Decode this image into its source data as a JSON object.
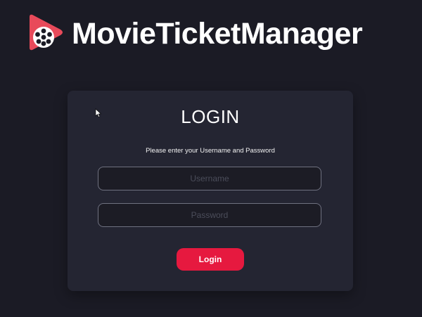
{
  "app": {
    "brand_name": "MovieTicketManager",
    "logo_icon": "film-reel-play-icon",
    "accent_color": "#e6193f"
  },
  "login_card": {
    "title": "LOGIN",
    "subtitle": "Please enter your Username and Password",
    "username": {
      "placeholder": "Username",
      "value": ""
    },
    "password": {
      "placeholder": "Password",
      "value": ""
    },
    "submit_label": "Login"
  },
  "cursor_icon": "mouse-pointer-icon"
}
